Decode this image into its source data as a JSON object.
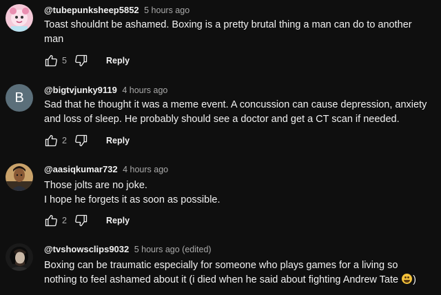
{
  "comments": [
    {
      "author": "@tubepunksheep5852",
      "time": "5 hours ago",
      "lines": [
        "Toast shouldnt be ashamed. Boxing is a pretty brutal thing a man can do to another",
        "man"
      ],
      "likes": "5",
      "reply_label": "Reply",
      "avatar": "pink-cartoon-avatar"
    },
    {
      "author": "@bigtvjunky9119",
      "time": "4 hours ago",
      "lines": [
        "Sad that he thought it was a meme event.  A concussion can cause depression, anxiety",
        "and loss of sleep.  He probably should see a doctor and get a CT scan if needed."
      ],
      "likes": "2",
      "reply_label": "Reply",
      "avatar_letter": "B",
      "avatar_color": "#5b6f7a"
    },
    {
      "author": "@aasiqkumar732",
      "time": "4 hours ago",
      "lines": [
        "Those jolts are no joke.",
        "I hope he forgets it as soon as possible."
      ],
      "likes": "2",
      "reply_label": "Reply",
      "avatar": "person-photo-avatar"
    },
    {
      "author": "@tvshowsclips9032",
      "time": "5 hours ago (edited)",
      "lines": [
        "Boxing can be traumatic especially for someone who plays games for a living so",
        "nothing to feel ashamed about it (i died when he said about fighting Andrew Tate"
      ],
      "line_suffix": ")",
      "emoji": "laughing-emoji",
      "avatar": "dark-portrait-avatar"
    }
  ],
  "icons": {
    "like": "thumbs-up-icon",
    "dislike": "thumbs-down-icon"
  }
}
